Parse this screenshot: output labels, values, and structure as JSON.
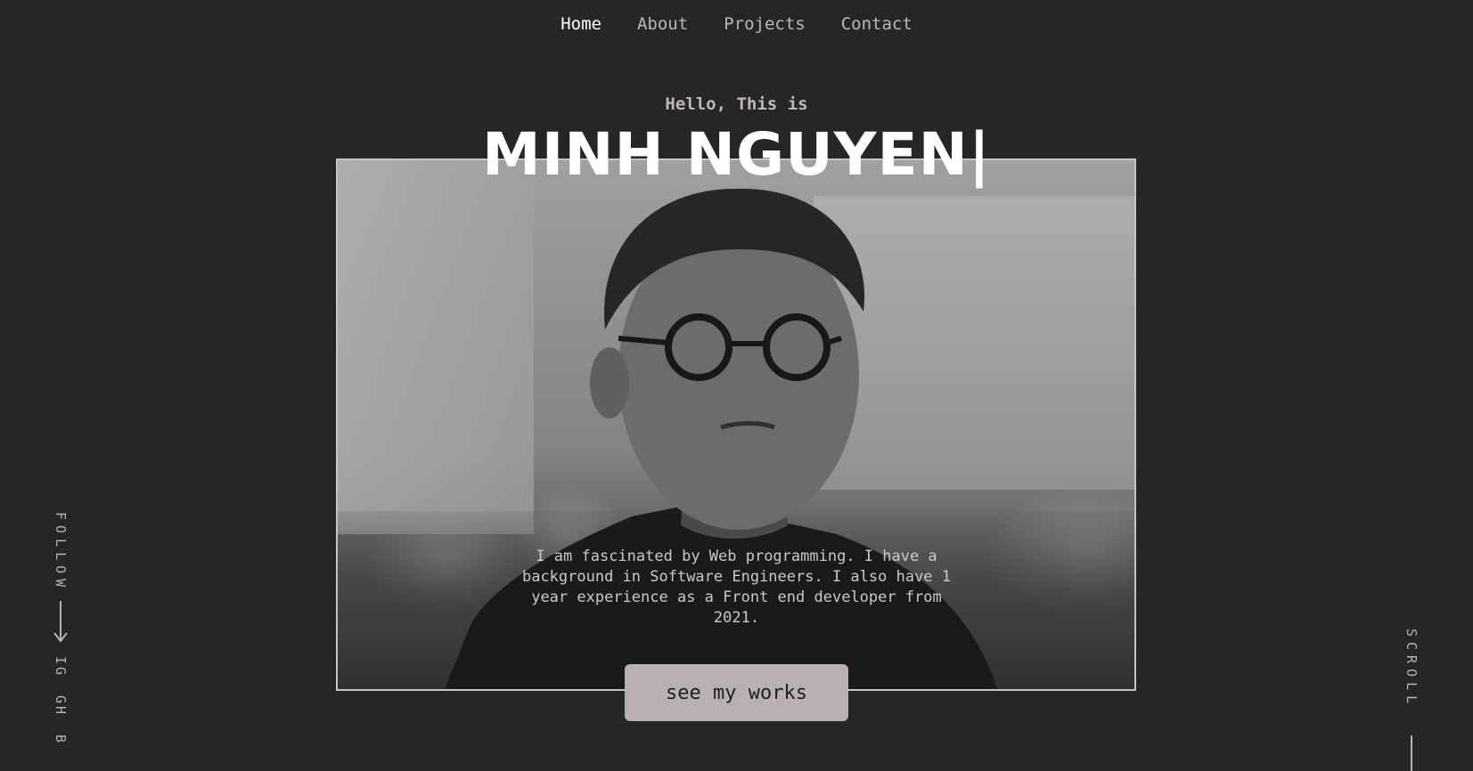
{
  "nav": {
    "items": [
      {
        "label": "Home",
        "active": true
      },
      {
        "label": "About",
        "active": false
      },
      {
        "label": "Projects",
        "active": false
      },
      {
        "label": "Contact",
        "active": false
      }
    ]
  },
  "hero": {
    "greeting": "Hello, This is",
    "name": "MINH NGUYEN|",
    "bio": "I am fascinated by Web programming. I have a background in Software Engineers. I also have 1 year experience as a Front end developer from 2021.",
    "cta_label": "see my works"
  },
  "follow": {
    "label": "FOLLOW",
    "links": [
      "IG",
      "GH",
      "B"
    ]
  },
  "scroll": {
    "label": "SCROLL"
  },
  "colors": {
    "background": "#262626",
    "button": "#b9b1b1",
    "text_muted": "#bdb7b7",
    "text_white": "#ffffff"
  },
  "icons": {
    "follow_arrow": "arrow-down-icon"
  }
}
